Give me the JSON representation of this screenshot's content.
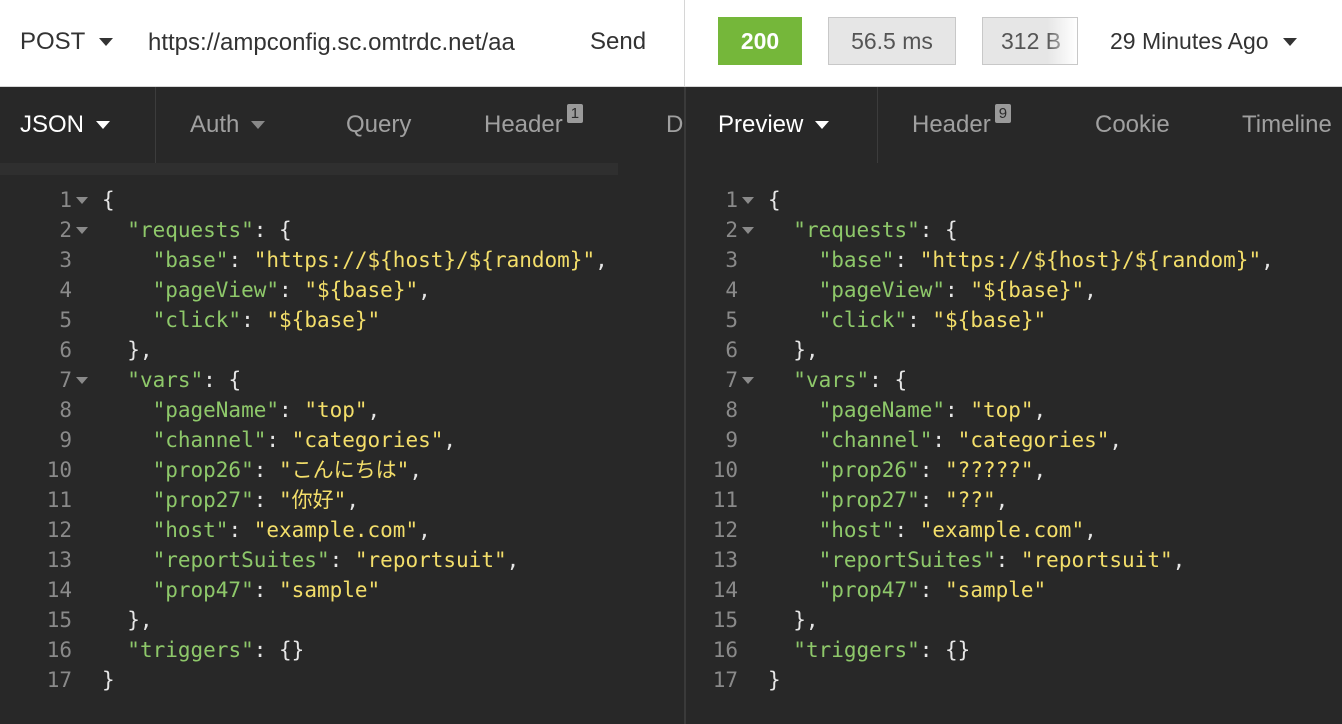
{
  "request": {
    "method": "POST",
    "url": "https://ampconfig.sc.omtrdc.net/aa",
    "send_label": "Send"
  },
  "response": {
    "status": "200",
    "time": "56.5 ms",
    "size": "312 B",
    "age": "29 Minutes Ago"
  },
  "left_tabs": [
    {
      "label": "JSON"
    },
    {
      "label": "Auth"
    },
    {
      "label": "Query"
    },
    {
      "label": "Header",
      "badge": "1"
    },
    {
      "label": "D"
    }
  ],
  "right_tabs": [
    {
      "label": "Preview"
    },
    {
      "label": "Header",
      "badge": "9"
    },
    {
      "label": "Cookie"
    },
    {
      "label": "Timeline"
    }
  ],
  "colors": {
    "status_ok": "#75b73a",
    "key": "#8ec86a",
    "string": "#f3de6a",
    "background": "#282828"
  },
  "request_body_lines": [
    [
      {
        "t": "p",
        "v": "{"
      }
    ],
    [
      {
        "t": "p",
        "v": "  "
      },
      {
        "t": "k",
        "v": "\"requests\""
      },
      {
        "t": "p",
        "v": ": {"
      }
    ],
    [
      {
        "t": "p",
        "v": "    "
      },
      {
        "t": "k",
        "v": "\"base\""
      },
      {
        "t": "p",
        "v": ": "
      },
      {
        "t": "s",
        "v": "\"https://${host}/${random}\""
      },
      {
        "t": "p",
        "v": ","
      }
    ],
    [
      {
        "t": "p",
        "v": "    "
      },
      {
        "t": "k",
        "v": "\"pageView\""
      },
      {
        "t": "p",
        "v": ": "
      },
      {
        "t": "s",
        "v": "\"${base}\""
      },
      {
        "t": "p",
        "v": ","
      }
    ],
    [
      {
        "t": "p",
        "v": "    "
      },
      {
        "t": "k",
        "v": "\"click\""
      },
      {
        "t": "p",
        "v": ": "
      },
      {
        "t": "s",
        "v": "\"${base}\""
      }
    ],
    [
      {
        "t": "p",
        "v": "  },"
      }
    ],
    [
      {
        "t": "p",
        "v": "  "
      },
      {
        "t": "k",
        "v": "\"vars\""
      },
      {
        "t": "p",
        "v": ": {"
      }
    ],
    [
      {
        "t": "p",
        "v": "    "
      },
      {
        "t": "k",
        "v": "\"pageName\""
      },
      {
        "t": "p",
        "v": ": "
      },
      {
        "t": "s",
        "v": "\"top\""
      },
      {
        "t": "p",
        "v": ","
      }
    ],
    [
      {
        "t": "p",
        "v": "    "
      },
      {
        "t": "k",
        "v": "\"channel\""
      },
      {
        "t": "p",
        "v": ": "
      },
      {
        "t": "s",
        "v": "\"categories\""
      },
      {
        "t": "p",
        "v": ","
      }
    ],
    [
      {
        "t": "p",
        "v": "    "
      },
      {
        "t": "k",
        "v": "\"prop26\""
      },
      {
        "t": "p",
        "v": ": "
      },
      {
        "t": "s",
        "v": "\"こんにちは\""
      },
      {
        "t": "p",
        "v": ","
      }
    ],
    [
      {
        "t": "p",
        "v": "    "
      },
      {
        "t": "k",
        "v": "\"prop27\""
      },
      {
        "t": "p",
        "v": ": "
      },
      {
        "t": "s",
        "v": "\"你好\""
      },
      {
        "t": "p",
        "v": ","
      }
    ],
    [
      {
        "t": "p",
        "v": "    "
      },
      {
        "t": "k",
        "v": "\"host\""
      },
      {
        "t": "p",
        "v": ": "
      },
      {
        "t": "s",
        "v": "\"example.com\""
      },
      {
        "t": "p",
        "v": ","
      }
    ],
    [
      {
        "t": "p",
        "v": "    "
      },
      {
        "t": "k",
        "v": "\"reportSuites\""
      },
      {
        "t": "p",
        "v": ": "
      },
      {
        "t": "s",
        "v": "\"reportsuit\""
      },
      {
        "t": "p",
        "v": ","
      }
    ],
    [
      {
        "t": "p",
        "v": "    "
      },
      {
        "t": "k",
        "v": "\"prop47\""
      },
      {
        "t": "p",
        "v": ": "
      },
      {
        "t": "s",
        "v": "\"sample\""
      }
    ],
    [
      {
        "t": "p",
        "v": "  },"
      }
    ],
    [
      {
        "t": "p",
        "v": "  "
      },
      {
        "t": "k",
        "v": "\"triggers\""
      },
      {
        "t": "p",
        "v": ": {}"
      }
    ],
    [
      {
        "t": "p",
        "v": "}"
      }
    ]
  ],
  "response_preview_lines": [
    [
      {
        "t": "p",
        "v": "{"
      }
    ],
    [
      {
        "t": "p",
        "v": "  "
      },
      {
        "t": "k",
        "v": "\"requests\""
      },
      {
        "t": "p",
        "v": ": {"
      }
    ],
    [
      {
        "t": "p",
        "v": "    "
      },
      {
        "t": "k",
        "v": "\"base\""
      },
      {
        "t": "p",
        "v": ": "
      },
      {
        "t": "s",
        "v": "\"https://${host}/${random}\""
      },
      {
        "t": "p",
        "v": ","
      }
    ],
    [
      {
        "t": "p",
        "v": "    "
      },
      {
        "t": "k",
        "v": "\"pageView\""
      },
      {
        "t": "p",
        "v": ": "
      },
      {
        "t": "s",
        "v": "\"${base}\""
      },
      {
        "t": "p",
        "v": ","
      }
    ],
    [
      {
        "t": "p",
        "v": "    "
      },
      {
        "t": "k",
        "v": "\"click\""
      },
      {
        "t": "p",
        "v": ": "
      },
      {
        "t": "s",
        "v": "\"${base}\""
      }
    ],
    [
      {
        "t": "p",
        "v": "  },"
      }
    ],
    [
      {
        "t": "p",
        "v": "  "
      },
      {
        "t": "k",
        "v": "\"vars\""
      },
      {
        "t": "p",
        "v": ": {"
      }
    ],
    [
      {
        "t": "p",
        "v": "    "
      },
      {
        "t": "k",
        "v": "\"pageName\""
      },
      {
        "t": "p",
        "v": ": "
      },
      {
        "t": "s",
        "v": "\"top\""
      },
      {
        "t": "p",
        "v": ","
      }
    ],
    [
      {
        "t": "p",
        "v": "    "
      },
      {
        "t": "k",
        "v": "\"channel\""
      },
      {
        "t": "p",
        "v": ": "
      },
      {
        "t": "s",
        "v": "\"categories\""
      },
      {
        "t": "p",
        "v": ","
      }
    ],
    [
      {
        "t": "p",
        "v": "    "
      },
      {
        "t": "k",
        "v": "\"prop26\""
      },
      {
        "t": "p",
        "v": ": "
      },
      {
        "t": "s",
        "v": "\"?????\""
      },
      {
        "t": "p",
        "v": ","
      }
    ],
    [
      {
        "t": "p",
        "v": "    "
      },
      {
        "t": "k",
        "v": "\"prop27\""
      },
      {
        "t": "p",
        "v": ": "
      },
      {
        "t": "s",
        "v": "\"??\""
      },
      {
        "t": "p",
        "v": ","
      }
    ],
    [
      {
        "t": "p",
        "v": "    "
      },
      {
        "t": "k",
        "v": "\"host\""
      },
      {
        "t": "p",
        "v": ": "
      },
      {
        "t": "s",
        "v": "\"example.com\""
      },
      {
        "t": "p",
        "v": ","
      }
    ],
    [
      {
        "t": "p",
        "v": "    "
      },
      {
        "t": "k",
        "v": "\"reportSuites\""
      },
      {
        "t": "p",
        "v": ": "
      },
      {
        "t": "s",
        "v": "\"reportsuit\""
      },
      {
        "t": "p",
        "v": ","
      }
    ],
    [
      {
        "t": "p",
        "v": "    "
      },
      {
        "t": "k",
        "v": "\"prop47\""
      },
      {
        "t": "p",
        "v": ": "
      },
      {
        "t": "s",
        "v": "\"sample\""
      }
    ],
    [
      {
        "t": "p",
        "v": "  },"
      }
    ],
    [
      {
        "t": "p",
        "v": "  "
      },
      {
        "t": "k",
        "v": "\"triggers\""
      },
      {
        "t": "p",
        "v": ": {}"
      }
    ],
    [
      {
        "t": "p",
        "v": "}"
      }
    ]
  ],
  "foldable_lines": [
    1,
    2,
    7
  ]
}
